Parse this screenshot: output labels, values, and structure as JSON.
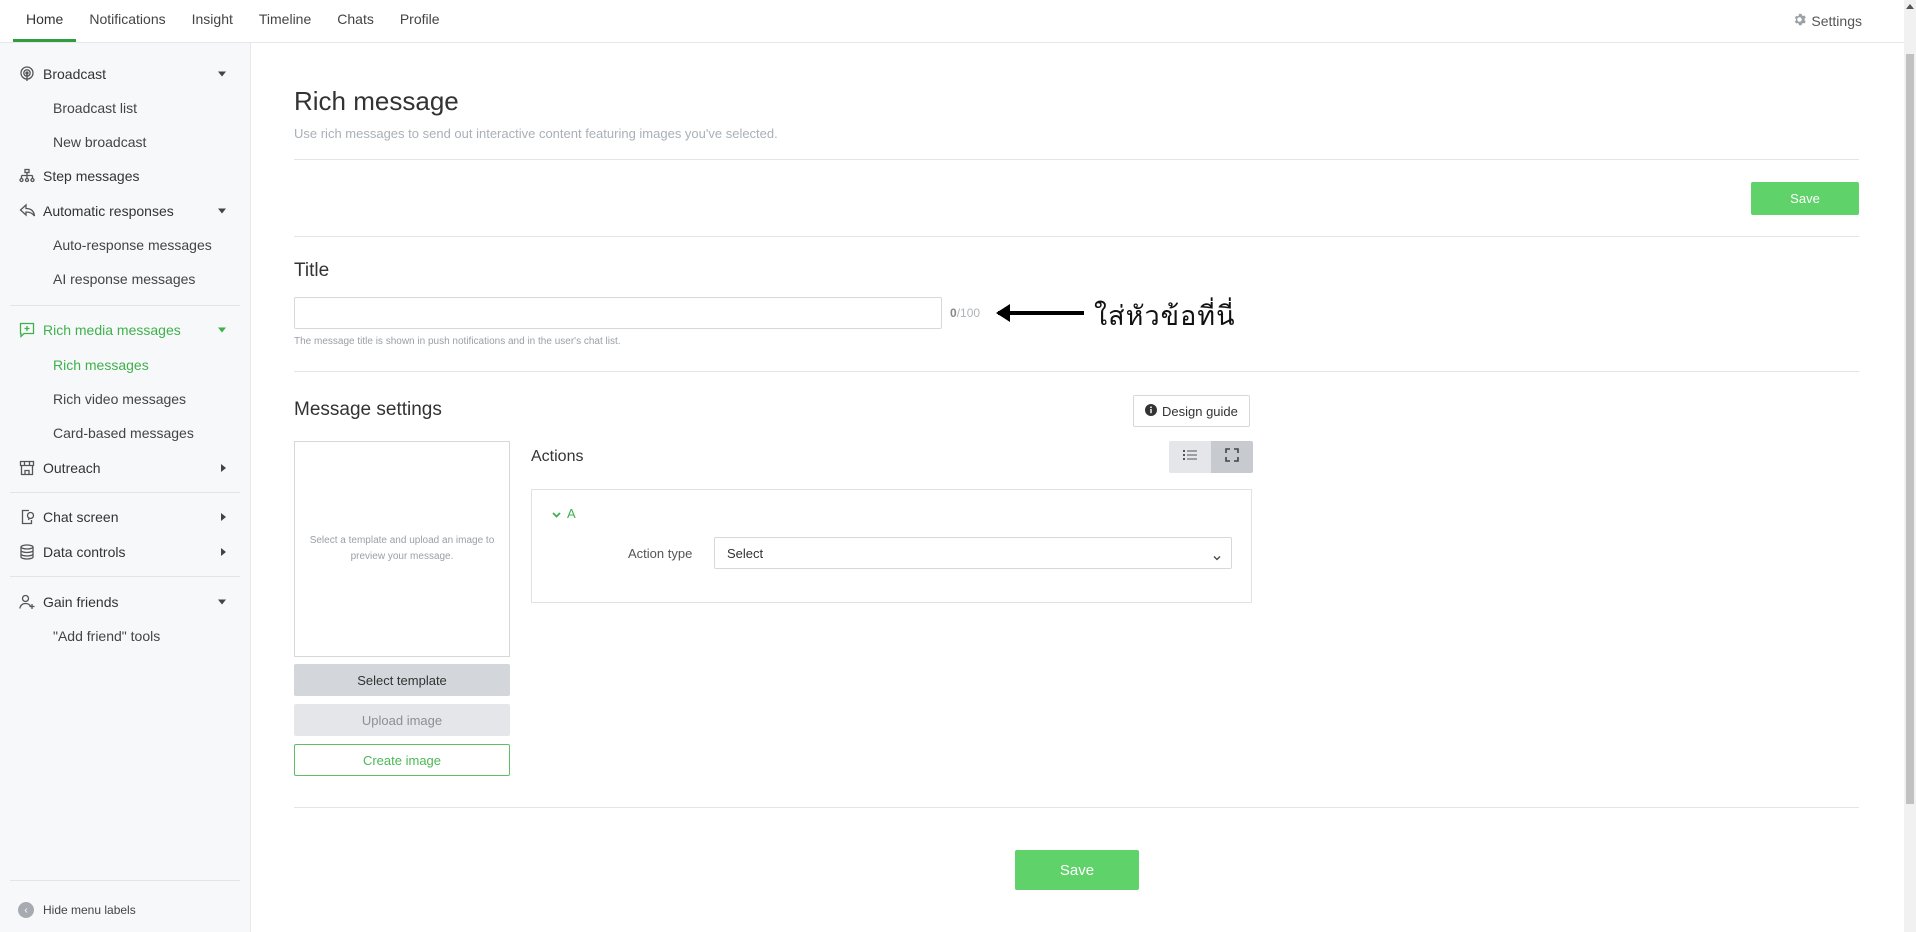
{
  "topnav": {
    "tabs": [
      {
        "label": "Home",
        "active": true
      },
      {
        "label": "Notifications",
        "active": false
      },
      {
        "label": "Insight",
        "active": false
      },
      {
        "label": "Timeline",
        "active": false
      },
      {
        "label": "Chats",
        "active": false
      },
      {
        "label": "Profile",
        "active": false
      }
    ],
    "settings_label": "Settings",
    "settings_icon": "gear-icon"
  },
  "sidebar": {
    "items": [
      {
        "label": "Broadcast",
        "icon": "broadcast-icon",
        "expanded": true,
        "children": [
          "Broadcast list",
          "New broadcast"
        ]
      },
      {
        "label": "Step messages",
        "icon": "hierarchy-icon"
      },
      {
        "label": "Automatic responses",
        "icon": "reply-icon",
        "expanded": true,
        "children": [
          "Auto-response messages",
          "AI response messages"
        ]
      },
      {
        "label": "Rich media messages",
        "icon": "add-message-icon",
        "expanded": true,
        "active": true,
        "children": [
          "Rich messages",
          "Rich video messages",
          "Card-based messages"
        ],
        "active_child": "Rich messages"
      },
      {
        "label": "Outreach",
        "icon": "store-icon",
        "expanded": false
      },
      {
        "label": "Chat screen",
        "icon": "phone-chat-icon",
        "expanded": false
      },
      {
        "label": "Data controls",
        "icon": "database-icon",
        "expanded": false
      },
      {
        "label": "Gain friends",
        "icon": "add-user-icon",
        "expanded": true,
        "children": [
          "\"Add friend\" tools"
        ]
      }
    ],
    "hide_labels": "Hide menu labels"
  },
  "page": {
    "title": "Rich message",
    "subtitle": "Use rich messages to send out interactive content featuring images you've selected.",
    "save_label": "Save",
    "title_section": {
      "heading": "Title",
      "value": "",
      "count": "0",
      "max": "/100",
      "helper": "The message title is shown in push notifications and in the user's chat list."
    },
    "annotation": "ใส่หัวข้อที่นี่",
    "message_settings": {
      "heading": "Message settings",
      "design_guide": "Design guide",
      "preview_placeholder": "Select a template and upload an image to preview your message.",
      "select_template": "Select template",
      "upload_image": "Upload image",
      "create_image": "Create image",
      "actions_heading": "Actions",
      "action_name": "A",
      "action_type_label": "Action type",
      "action_type_value": "Select"
    }
  },
  "colors": {
    "accent": "#3fb14b",
    "save_button": "#5fd26a"
  }
}
